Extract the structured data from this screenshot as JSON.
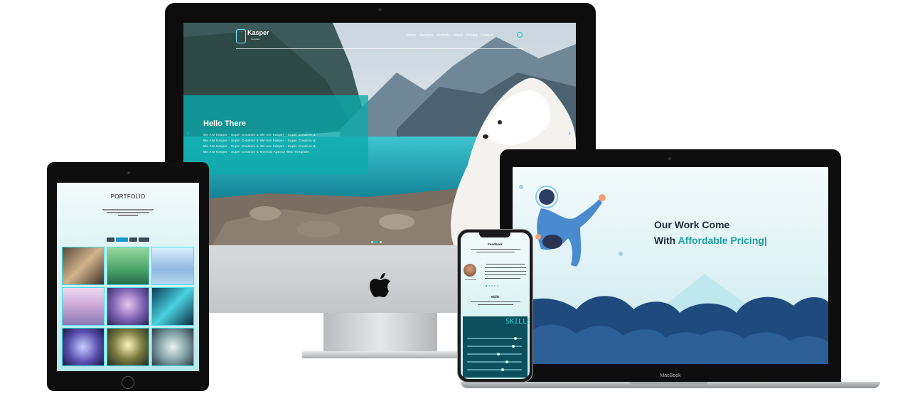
{
  "imac": {
    "brand_logo": "apple-logo",
    "site": {
      "logo_text": "Kasper",
      "logo_sub": "Template",
      "nav": [
        "Home",
        "Services",
        "Portfolio",
        "About",
        "Pricing",
        "Contact"
      ],
      "search_icon": "search-icon",
      "hero_title": "Hello There",
      "hero_lines": [
        "We Are Kasper - Super Creative & We Are Kasper - Super Creative &",
        "We Are Kasper - Super Creative & We Are Kasper - Super Creative &",
        "We Are Kasper - Super Creative & We Are Kasper - Super Creative &",
        "We Are Kasper - Super Creative & Minimal Agency Web Template"
      ],
      "accent": "#1cc7c9"
    }
  },
  "tablet": {
    "portfolio_title": "PORTFOLIO",
    "accent": "#38e0e8"
  },
  "macbook": {
    "label": "MacBook",
    "headline_1": "Our Work Come",
    "headline_2_plain": "With ",
    "headline_2_accent": "Affordable Pricing|",
    "accent": "#1aa39f"
  },
  "iphone": {
    "feedback_title": "Feedback",
    "skills_title": "Skills",
    "skills_banner": "SKILLS",
    "skill_levels": [
      0.86,
      0.82,
      0.55,
      0.7,
      0.62
    ]
  }
}
